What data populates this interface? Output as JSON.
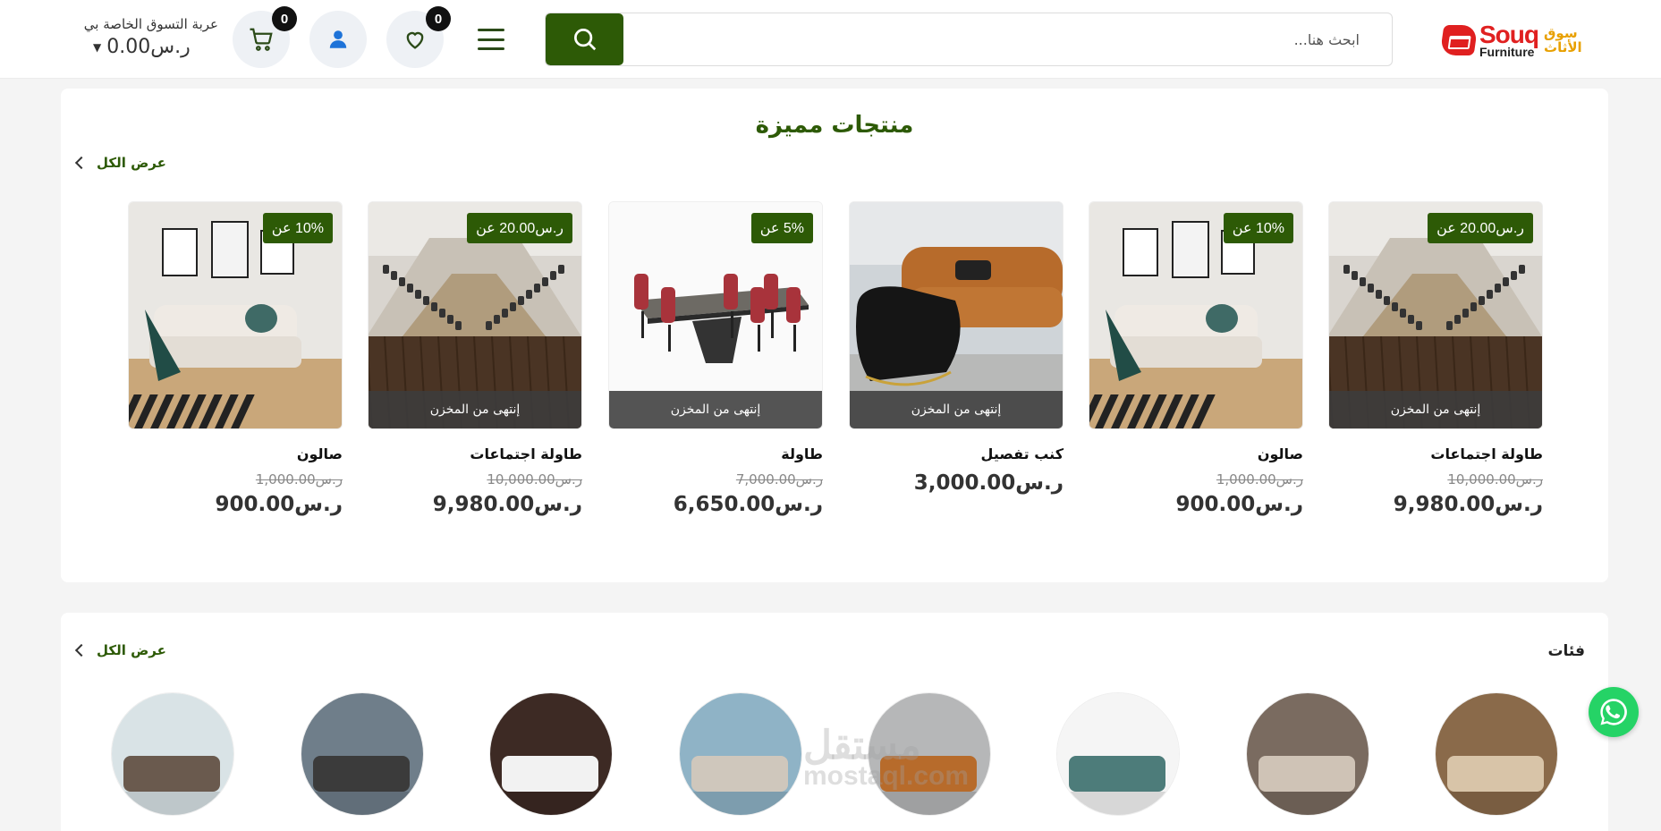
{
  "header": {
    "logo": {
      "brand_en": "Souq",
      "brand_sub": "Furniture",
      "brand_ar_1": "سوق",
      "brand_ar_2": "الأثاث"
    },
    "search": {
      "placeholder": "ابحث هنا..."
    },
    "wishlist_count": "0",
    "cart_count": "0",
    "cart_label": "عربة التسوق الخاصة بي",
    "cart_total": "ر.س0.00"
  },
  "featured": {
    "title": "منتجات مميزة",
    "view_all": "عرض الكل",
    "out_of_stock": "إنتهى من المخزن",
    "products": [
      {
        "name": "طاولة اجتماعات",
        "discount": "ر.س20.00 عن",
        "old_price": "ر.س10,000.00",
        "price": "ر.س9,980.00",
        "out_of_stock": true,
        "image": "conference-room"
      },
      {
        "name": "صالون",
        "discount": "10% عن",
        "old_price": "ر.س1,000.00",
        "price": "ر.س900.00",
        "out_of_stock": false,
        "image": "living-room"
      },
      {
        "name": "كنب تفصيل",
        "discount": "",
        "old_price": "",
        "price": "ر.س3,000.00",
        "out_of_stock": true,
        "image": "tufted-sofa"
      },
      {
        "name": "طاولة",
        "discount": "5% عن",
        "old_price": "ر.س7,000.00",
        "price": "ر.س6,650.00",
        "out_of_stock": true,
        "image": "office-table"
      },
      {
        "name": "طاولة اجتماعات",
        "discount": "ر.س20.00 عن",
        "old_price": "ر.س10,000.00",
        "price": "ر.س9,980.00",
        "out_of_stock": true,
        "image": "conference-room"
      },
      {
        "name": "صالون",
        "discount": "10% عن",
        "old_price": "ر.س1,000.00",
        "price": "ر.س900.00",
        "out_of_stock": false,
        "image": "living-room"
      }
    ]
  },
  "categories": {
    "title": "فئات",
    "view_all": "عرض الكل",
    "items": [
      "bedroom",
      "dining",
      "sofa",
      "living",
      "dining-blue",
      "desk-accessories",
      "office",
      "glass-desk"
    ]
  },
  "watermark": {
    "line1": "مستقل",
    "line2": "mostaql.com"
  },
  "colors": {
    "brand_green": "#2d5a06",
    "logo_red": "#e02020",
    "whatsapp": "#25d366"
  }
}
